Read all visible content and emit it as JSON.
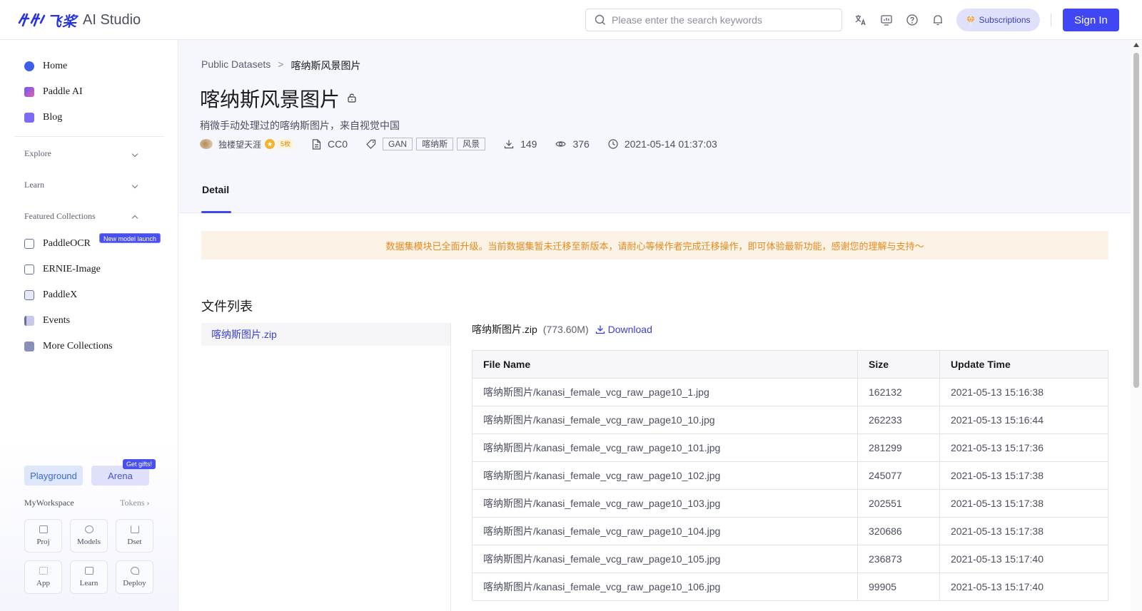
{
  "header": {
    "logo_cn": "飞桨",
    "logo_en": "AI Studio",
    "search_placeholder": "Please enter the search keywords",
    "subscriptions": "Subscriptions",
    "sign_in": "Sign In"
  },
  "sidebar": {
    "top_items": [
      {
        "label": "Home",
        "icon": "home-icon"
      },
      {
        "label": "Paddle AI",
        "icon": "paddle-ai-icon"
      },
      {
        "label": "Blog",
        "icon": "blog-icon"
      }
    ],
    "sections": {
      "explore": "Explore",
      "learn": "Learn",
      "featured": "Featured Collections"
    },
    "featured_items": [
      {
        "label": "PaddleOCR",
        "icon": "ocr-icon"
      },
      {
        "label": "ERNIE-Image",
        "icon": "image-icon"
      },
      {
        "label": "PaddleX",
        "icon": "paddlex-icon"
      },
      {
        "label": "Events",
        "icon": "flag-icon"
      },
      {
        "label": "More Collections",
        "icon": "collection-icon"
      }
    ],
    "new_badge": "New model launch",
    "playground": "Playground",
    "arena": "Arena",
    "gift_badge": "Get gifts!",
    "workspace": "MyWorkspace",
    "tokens": "Tokens",
    "tiles": [
      {
        "label": "Proj"
      },
      {
        "label": "Models"
      },
      {
        "label": "Dset"
      },
      {
        "label": "App"
      },
      {
        "label": "Learn"
      },
      {
        "label": "Deploy"
      }
    ]
  },
  "breadcrumb": {
    "parent": "Public Datasets",
    "sep": ">",
    "current": "喀纳斯风景图片"
  },
  "dataset": {
    "title": "喀纳斯风景图片",
    "subtitle": "稍微手动处理过的喀纳斯图片，来自视觉中国",
    "author": "独楼望天涯",
    "level": "5枚",
    "license": "CC0",
    "tags": [
      "GAN",
      "喀纳斯",
      "风景"
    ],
    "downloads": "149",
    "views": "376",
    "updated": "2021-05-14 01:37:03"
  },
  "tabs": {
    "detail": "Detail"
  },
  "notice": "数据集模块已全面升级。当前数据集暂未迁移至新版本，请耐心等候作者完成迁移操作，即可体验最新功能，感谢您的理解与支持～",
  "files": {
    "heading": "文件列表",
    "list": [
      "喀纳斯图片.zip"
    ],
    "selected_name": "喀纳斯图片.zip",
    "selected_size": "(773.60M)",
    "download": "Download",
    "columns": [
      "File Name",
      "Size",
      "Update Time"
    ],
    "rows": [
      [
        "喀纳斯图片/kanasi_female_vcg_raw_page10_1.jpg",
        "162132",
        "2021-05-13 15:16:38"
      ],
      [
        "喀纳斯图片/kanasi_female_vcg_raw_page10_10.jpg",
        "262233",
        "2021-05-13 15:16:44"
      ],
      [
        "喀纳斯图片/kanasi_female_vcg_raw_page10_101.jpg",
        "281299",
        "2021-05-13 15:17:36"
      ],
      [
        "喀纳斯图片/kanasi_female_vcg_raw_page10_102.jpg",
        "245077",
        "2021-05-13 15:17:38"
      ],
      [
        "喀纳斯图片/kanasi_female_vcg_raw_page10_103.jpg",
        "202551",
        "2021-05-13 15:17:38"
      ],
      [
        "喀纳斯图片/kanasi_female_vcg_raw_page10_104.jpg",
        "320686",
        "2021-05-13 15:17:38"
      ],
      [
        "喀纳斯图片/kanasi_female_vcg_raw_page10_105.jpg",
        "236873",
        "2021-05-13 15:17:40"
      ],
      [
        "喀纳斯图片/kanasi_female_vcg_raw_page10_106.jpg",
        "99905",
        "2021-05-13 15:17:40"
      ]
    ]
  },
  "colors": {
    "accent": "#4047f2",
    "link": "#3a3fd8",
    "notice_bg": "#fdf2e6",
    "notice_text": "#e58a1c"
  }
}
